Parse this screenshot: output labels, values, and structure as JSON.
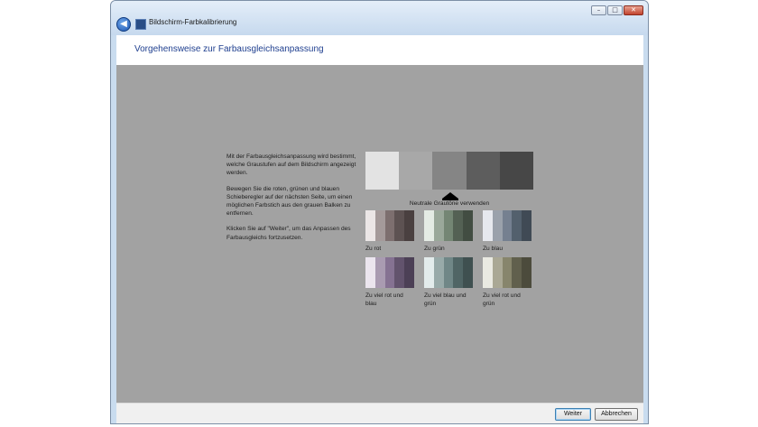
{
  "window": {
    "title": "Bildschirm-Farbkalibrierung",
    "minimize_glyph": "–",
    "maximize_glyph": "□",
    "close_glyph": "✕"
  },
  "header": {
    "title": "Vorgehensweise zur Farbausgleichsanpassung"
  },
  "instructions": {
    "p1": "Mit der Farbausgleichsanpassung wird bestimmt, welche Graustufen auf dem Bildschirm angezeigt werden.",
    "p2": "Bewegen Sie die roten, grünen und blauen Schieberegler auf der nächsten Seite, um einen möglichen Farbstich aus den grauen Balken zu entfernen.",
    "p3": "Klicken Sie auf \"Weiter\", um das Anpassen des Farbausgleichs fortzusetzen."
  },
  "reference": {
    "label": "Neutrale Grautöne verwenden",
    "colors": [
      "#e3e3e3",
      "#a8a8a8",
      "#858585",
      "#5d5d5d",
      "#474747"
    ]
  },
  "samples": [
    {
      "label": "Zu rot",
      "colors": [
        "#ebe6e6",
        "#a49a9a",
        "#7d6f6f",
        "#5d5252",
        "#4a4040"
      ]
    },
    {
      "label": "Zu grün",
      "colors": [
        "#e4ebe4",
        "#9aa89a",
        "#748674",
        "#546154",
        "#424d42"
      ]
    },
    {
      "label": "Zu blau",
      "colors": [
        "#e6e8ee",
        "#9aa1ab",
        "#758090",
        "#53606d",
        "#404a55"
      ]
    },
    {
      "label": "Zu viel rot und blau",
      "colors": [
        "#ebe5ee",
        "#a99bb1",
        "#857292",
        "#62536d",
        "#4c4056"
      ]
    },
    {
      "label": "Zu viel blau und grün",
      "colors": [
        "#e3ecec",
        "#98aaa9",
        "#708787",
        "#506565",
        "#3f5050"
      ]
    },
    {
      "label": "Zu viel rot und grün",
      "colors": [
        "#eaeae2",
        "#aaa895",
        "#87856c",
        "#61604d",
        "#4c4b3c"
      ]
    }
  ],
  "footer": {
    "next_label": "Weiter",
    "cancel_label": "Abbrechen"
  }
}
